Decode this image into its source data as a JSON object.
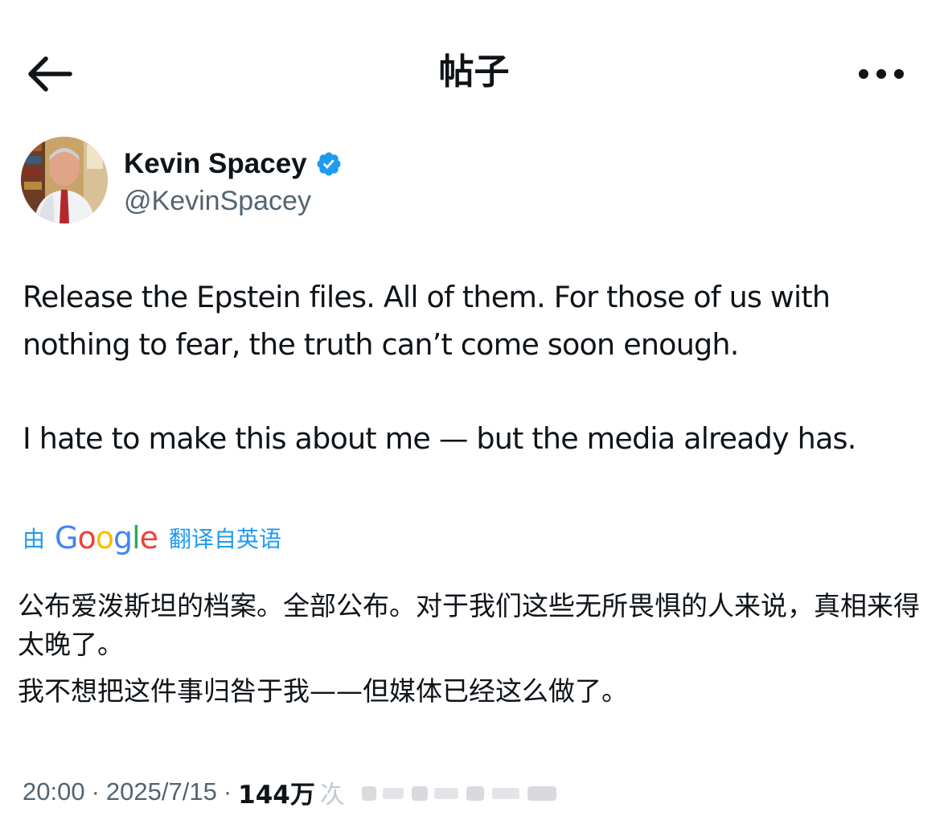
{
  "header": {
    "title": "帖子",
    "back_icon": "arrow-left-icon",
    "more_icon": "more-horizontal-icon"
  },
  "author": {
    "name": "Kevin Spacey",
    "handle": "@KevinSpacey",
    "verified_color": "#1d9bf0"
  },
  "tweet": {
    "paragraphs": [
      "Release the Epstein files. All of them. For those of us with nothing to fear, the truth can’t come soon enough.",
      "I hate to make this about me — but the media already has."
    ]
  },
  "translation": {
    "prefix": "由",
    "provider": "Google",
    "suffix": "翻译自英语",
    "paragraphs": [
      "公布爱泼斯坦的档案。全部公布。对于我们这些无所畏惧的人来说，真相来得太晚了。",
      "我不想把这件事归咎于我——但媒体已经这么做了。"
    ]
  },
  "meta": {
    "time": "20:00",
    "separator": "·",
    "date": "2025/7/15",
    "views": "144万",
    "views_suffix": "次"
  },
  "colors": {
    "text": "#0f1419",
    "secondary": "#536471",
    "link": "#1d9bf0"
  }
}
